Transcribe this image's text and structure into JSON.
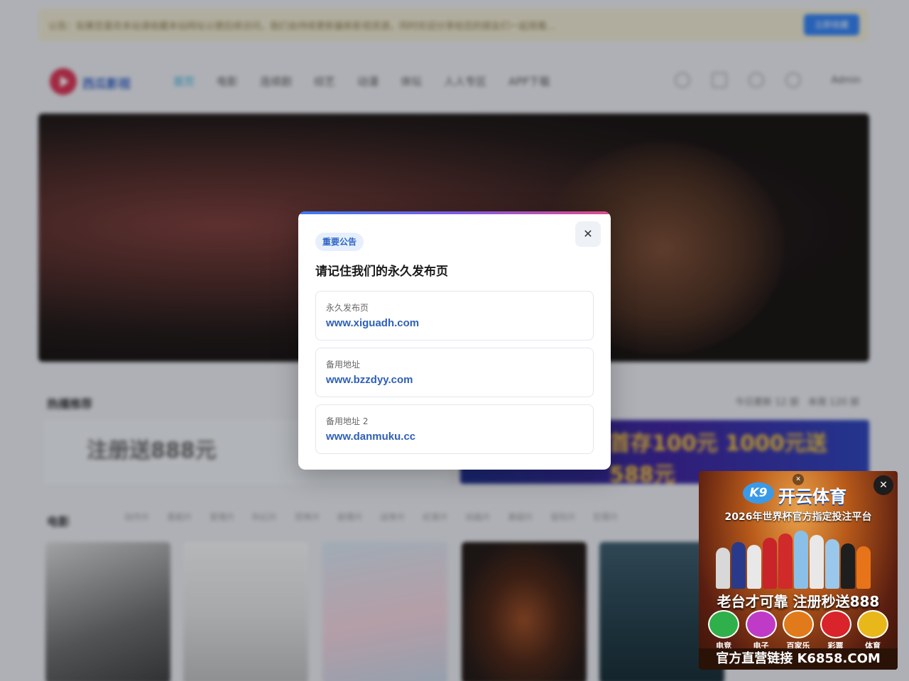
{
  "background": {
    "notice": {
      "text": "公告：如果您喜欢本站请收藏本站网址以便后续访问，我们会持续更新最新影视资源，同时欢迎分享给您的朋友们一起观看…",
      "button_label": "立即收藏"
    },
    "header": {
      "logo_text": "西瓜影视",
      "nav": [
        "首页",
        "电影",
        "连续剧",
        "综艺",
        "动漫",
        "体坛",
        "人人专区",
        "APP下载"
      ],
      "user_label": "Admin"
    },
    "hot_section": {
      "title": "热播推荐",
      "more": "今日更新 12 部　本周 120 部"
    },
    "banner_left_text": "注册送888元",
    "banner_right_text": "首存100元 1000元送588元",
    "movie_section": {
      "title": "电影",
      "categories": [
        "动作片",
        "喜剧片",
        "爱情片",
        "科幻片",
        "恐怖片",
        "剧情片",
        "战争片",
        "纪录片",
        "动画片",
        "悬疑片",
        "冒险片",
        "犯罪片",
        "奇幻片"
      ]
    }
  },
  "modal": {
    "badge": "重要公告",
    "title": "请记住我们的永久发布页",
    "close_glyph": "✕",
    "addresses": [
      {
        "label": "永久发布页",
        "url": "www.xiguadh.com"
      },
      {
        "label": "备用地址",
        "url": "www.bzzdyy.com"
      },
      {
        "label": "备用地址 2",
        "url": "www.danmuku.cc"
      }
    ]
  },
  "ad": {
    "close_glyph": "✕",
    "mini_close_glyph": "✕",
    "logo_mark": "K9",
    "brand": "开云体育",
    "tagline": "2026年世界杯官方指定投注平台",
    "slogan": "老台才可靠 注册秒送888",
    "categories": [
      {
        "label": "电竞",
        "color": "#2fb04a"
      },
      {
        "label": "电子",
        "color": "#c03ac8"
      },
      {
        "label": "百家乐",
        "color": "#e07a1a"
      },
      {
        "label": "彩票",
        "color": "#d8242a"
      },
      {
        "label": "体育",
        "color": "#e8b81a"
      }
    ],
    "link_text": "官方直营链接 K6858.COM"
  },
  "colors": {
    "accent_blue": "#2f5fb8",
    "badge_bg": "#e6effb",
    "gradient": [
      "#3a7bef",
      "#7a5be6",
      "#e04a8a"
    ]
  }
}
